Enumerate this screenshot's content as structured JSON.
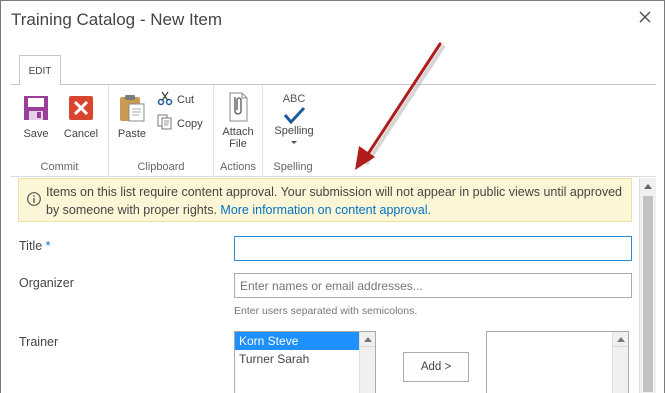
{
  "window": {
    "title": "Training Catalog - New Item"
  },
  "ribbon": {
    "tab": "EDIT",
    "groups": {
      "commit": {
        "label": "Commit",
        "save": "Save",
        "cancel": "Cancel"
      },
      "clipboard": {
        "label": "Clipboard",
        "paste": "Paste",
        "cut": "Cut",
        "copy": "Copy"
      },
      "actions": {
        "label": "Actions",
        "attach_line1": "Attach",
        "attach_line2": "File"
      },
      "spelling": {
        "label": "Spelling",
        "button": "Spelling",
        "abc": "ABC"
      }
    }
  },
  "notice": {
    "text": "Items on this list require content approval. Your submission will not appear in public views until approved by someone with proper rights.",
    "link": "More information on content approval."
  },
  "form": {
    "title": {
      "label": "Title",
      "required_mark": "*",
      "value": ""
    },
    "organizer": {
      "label": "Organizer",
      "placeholder": "Enter names or email addresses...",
      "hint": "Enter users separated with semicolons."
    },
    "trainer": {
      "label": "Trainer",
      "options": [
        "Korn Steve",
        "Turner Sarah"
      ],
      "selected": "Korn Steve",
      "add_button": "Add >"
    }
  },
  "colors": {
    "accent": "#0072c6",
    "notice_bg": "#fdf6d6",
    "annotation_arrow": "#b01c1c",
    "selection": "#1e90ff"
  },
  "icons": [
    "close-icon",
    "save-icon",
    "cancel-icon",
    "paste-icon",
    "cut-icon",
    "copy-icon",
    "attach-file-icon",
    "spelling-icon",
    "info-icon"
  ]
}
